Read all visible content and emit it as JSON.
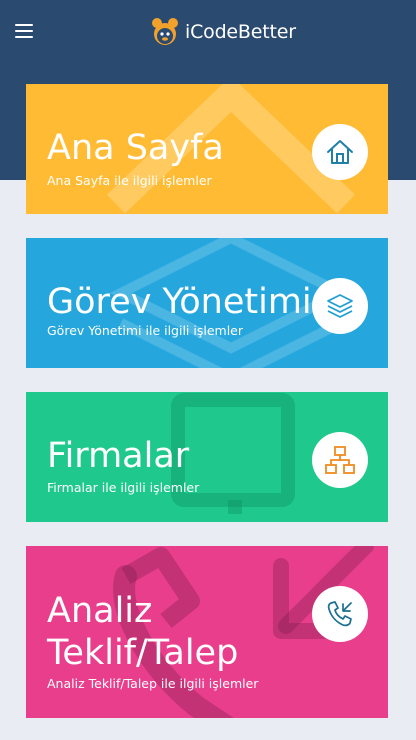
{
  "app": {
    "brand": "iCodeBetter"
  },
  "colors": {
    "header": "#2b4a6f",
    "page_bg": "#e9edf3",
    "card_yellow": "#ffbb33",
    "card_blue": "#25a7dd",
    "card_green": "#1fc98e",
    "card_pink": "#e83e8c"
  },
  "cards": [
    {
      "title": "Ana Sayfa",
      "subtitle": "Ana Sayfa ile ilgili işlemler",
      "icon": "home-icon"
    },
    {
      "title": "Görev Yönetimi",
      "subtitle": "Görev Yönetimi ile ilgili işlemler",
      "icon": "layers-icon"
    },
    {
      "title": "Firmalar",
      "subtitle": "Firmalar ile ilgili işlemler",
      "icon": "sitemap-icon"
    },
    {
      "title_line1": "Analiz",
      "title_line2": "Teklif/Talep",
      "subtitle": "Analiz Teklif/Talep ile ilgili işlemler",
      "icon": "phone-incoming-icon"
    }
  ]
}
